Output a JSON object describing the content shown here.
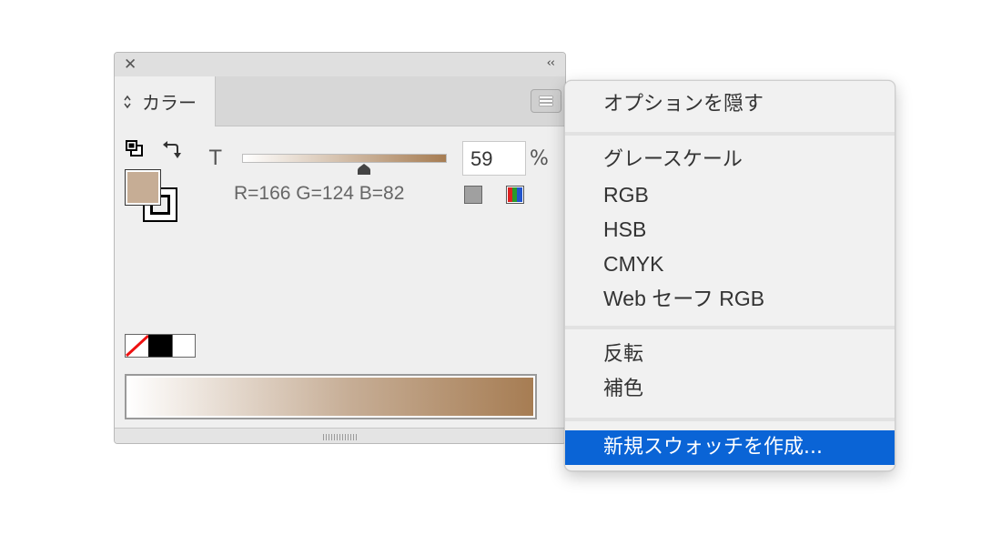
{
  "panel": {
    "close_glyph": "✕",
    "collapse_glyph": "‹‹",
    "tab_label": "カラー",
    "tint_label": "T",
    "tint_value": "59",
    "tint_percent_symbol": "%",
    "tint_level_percent": 59,
    "rgb_readout": "R=166 G=124 B=82",
    "base_color": "#a67c52",
    "tint_color": "#c6ad95"
  },
  "menu": {
    "hide_options": "オプションを隠す",
    "grayscale": "グレースケール",
    "rgb": "RGB",
    "hsb": "HSB",
    "cmyk": "CMYK",
    "web_safe_rgb": "Web セーフ RGB",
    "invert": "反転",
    "complement": "補色",
    "new_swatch": "新規スウォッチを作成...",
    "highlight_color": "#0a64d6"
  }
}
